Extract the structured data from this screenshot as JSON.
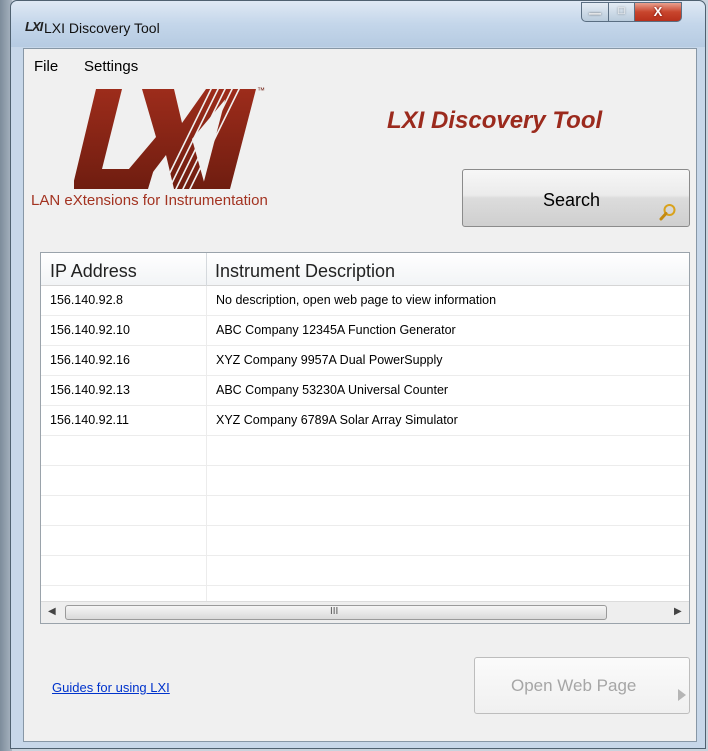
{
  "window": {
    "app_icon_text": "LXI",
    "title": "LXI Discovery Tool",
    "controls": {
      "minimize": "—",
      "maximize": "□",
      "close": "X"
    }
  },
  "menu": {
    "items": [
      {
        "label": "File"
      },
      {
        "label": "Settings"
      }
    ]
  },
  "branding": {
    "logo_text": "LXI",
    "tagline": "LAN eXtensions for Instrumentation",
    "heading": "LXI Discovery Tool",
    "brand_color": "#a33321"
  },
  "search_button": {
    "label": "Search",
    "icon": "magnifier-icon"
  },
  "instrument_list": {
    "columns": [
      "IP Address",
      "Instrument Description"
    ],
    "rows": [
      {
        "ip": "156.140.92.8",
        "description": "No description, open web page to view information"
      },
      {
        "ip": "156.140.92.10",
        "description": "ABC Company 12345A Function Generator"
      },
      {
        "ip": "156.140.92.16",
        "description": "XYZ Company 9957A Dual PowerSupply"
      },
      {
        "ip": "156.140.92.13",
        "description": "ABC Company 53230A Universal Counter"
      },
      {
        "ip": "156.140.92.11",
        "description": "XYZ Company 6789A Solar Array Simulator"
      }
    ],
    "scrollbar": {
      "left": "◀",
      "grip": "III",
      "right": "▶"
    }
  },
  "footer": {
    "guides_link": "Guides for using LXI",
    "open_button": {
      "label": "Open Web Page",
      "enabled": false
    }
  }
}
